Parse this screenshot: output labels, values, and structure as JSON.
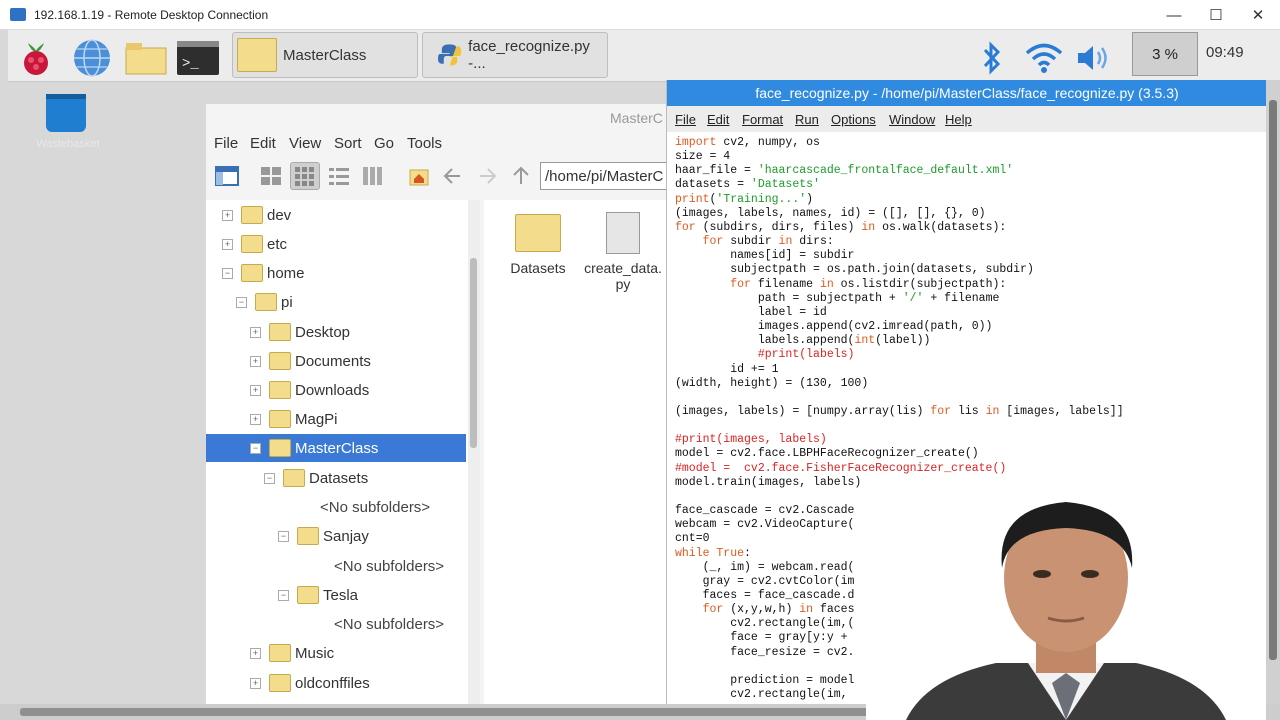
{
  "window": {
    "title": "192.168.1.19 - Remote Desktop Connection",
    "minimize": "—",
    "maximize": "☐",
    "close": "✕"
  },
  "taskbar": {
    "tasks": [
      {
        "label": "MasterClass"
      },
      {
        "label": "face_recognize.py -..."
      }
    ],
    "cpu": "3 %",
    "clock": "09:49"
  },
  "desktop": {
    "trash_label": "Wastebasket"
  },
  "file_manager": {
    "title": "MasterC",
    "menu": [
      "File",
      "Edit",
      "View",
      "Sort",
      "Go",
      "Tools"
    ],
    "path": "/home/pi/MasterC",
    "tree": [
      {
        "label": "dev"
      },
      {
        "label": "etc"
      },
      {
        "label": "home"
      },
      {
        "label": "pi"
      },
      {
        "label": "Desktop"
      },
      {
        "label": "Documents"
      },
      {
        "label": "Downloads"
      },
      {
        "label": "MagPi"
      },
      {
        "label": "MasterClass"
      },
      {
        "label": "Datasets"
      },
      {
        "label": "<No subfolders>"
      },
      {
        "label": "Sanjay"
      },
      {
        "label": "<No subfolders>"
      },
      {
        "label": "Tesla"
      },
      {
        "label": "<No subfolders>"
      },
      {
        "label": "Music"
      },
      {
        "label": "oldconffiles"
      }
    ],
    "files": [
      {
        "name": "Datasets"
      },
      {
        "name": "create_data.py"
      }
    ]
  },
  "editor": {
    "title": "face_recognize.py - /home/pi/MasterClass/face_recognize.py (3.5.3)",
    "menu": [
      "File",
      "Edit",
      "Format",
      "Run",
      "Options",
      "Window",
      "Help"
    ]
  },
  "colors": {
    "selection": "#3a7ad6",
    "editor_title": "#2f8ae0",
    "keyword": "#e05a1e",
    "string": "#1c9c2a"
  }
}
